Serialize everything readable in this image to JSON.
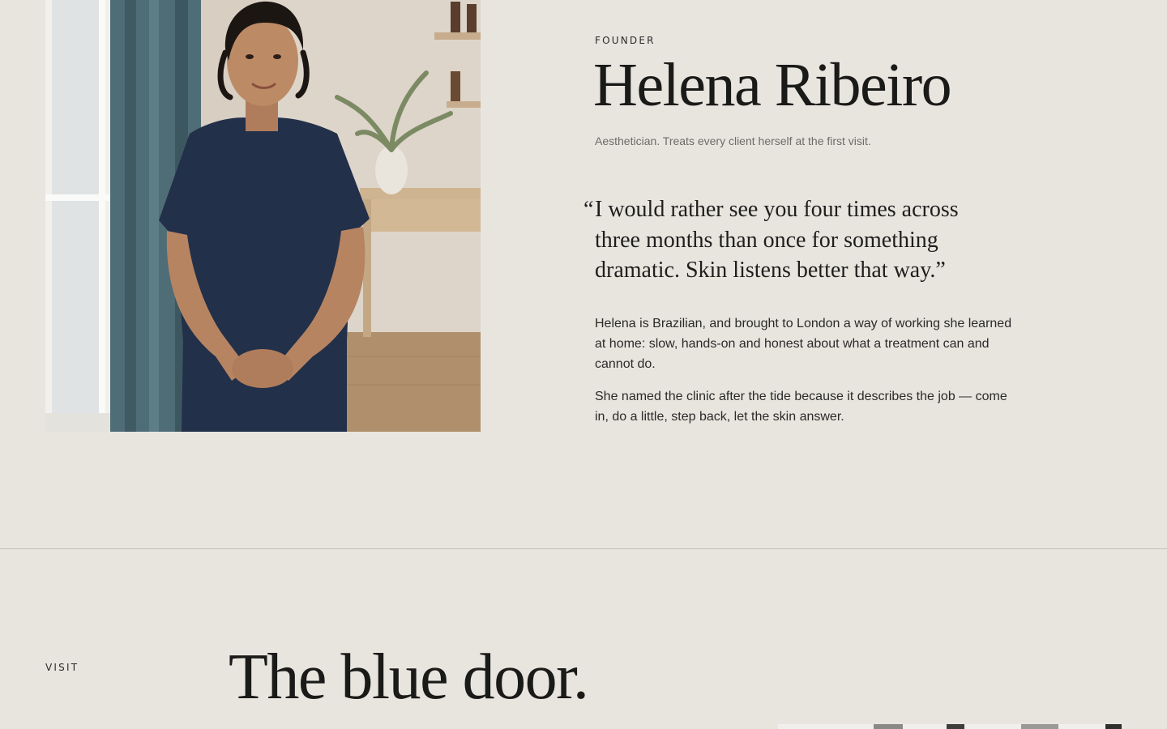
{
  "founder": {
    "eyebrow": "FOUNDER",
    "name": "Helena Ribeiro",
    "role": "Aesthetician. Treats every client herself at the first visit.",
    "quote_open": "“",
    "quote_text": "I would rather see you four times across three months than once for something dramatic. Skin listens better that way.”",
    "bio": [
      "Helena is Brazilian, and brought to London a way of working she learned at home: slow, hands-on and honest about what a treatment can and cannot do.",
      "She named the clinic after the tide because it describes the job — come in, do a little, step back, let the skin answer."
    ]
  },
  "visit": {
    "eyebrow": "VISIT",
    "title": "The blue door."
  },
  "colors": {
    "background": "#e8e5df",
    "text": "#1c1c1a",
    "muted_text": "#6e6b66",
    "divider": "#c4c0b9"
  }
}
